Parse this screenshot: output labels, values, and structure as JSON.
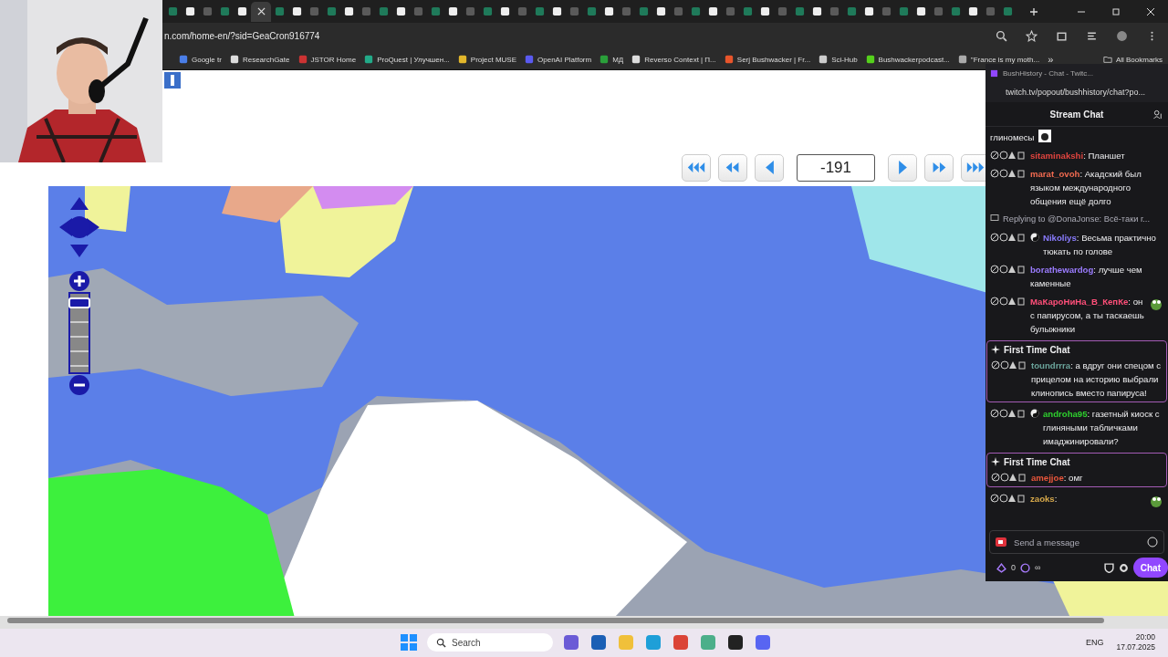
{
  "browser": {
    "tabs": [
      {
        "selected": false
      },
      {
        "selected": false
      },
      {
        "selected": false
      },
      {
        "selected": false
      },
      {
        "selected": false
      },
      {
        "selected": true
      },
      {
        "selected": false
      },
      {
        "selected": false
      },
      {
        "selected": false
      },
      {
        "selected": false
      },
      {
        "selected": false
      },
      {
        "selected": false
      },
      {
        "selected": false
      },
      {
        "selected": false
      },
      {
        "selected": false
      },
      {
        "selected": false
      },
      {
        "selected": false
      },
      {
        "selected": false
      },
      {
        "selected": false
      },
      {
        "selected": false
      },
      {
        "selected": false
      },
      {
        "selected": false
      },
      {
        "selected": false
      },
      {
        "selected": false
      },
      {
        "selected": false
      },
      {
        "selected": false
      },
      {
        "selected": false
      },
      {
        "selected": false
      },
      {
        "selected": false
      },
      {
        "selected": false
      },
      {
        "selected": false
      },
      {
        "selected": false
      },
      {
        "selected": false
      },
      {
        "selected": false
      },
      {
        "selected": false
      },
      {
        "selected": false
      },
      {
        "selected": false
      },
      {
        "selected": false
      },
      {
        "selected": false
      },
      {
        "selected": false
      },
      {
        "selected": false
      },
      {
        "selected": false
      },
      {
        "selected": false
      },
      {
        "selected": false
      },
      {
        "selected": false
      },
      {
        "selected": false
      },
      {
        "selected": false
      },
      {
        "selected": false
      },
      {
        "selected": false
      }
    ],
    "address": "n.com/home-en/?sid=GeaCron916774",
    "bookmarks": [
      "Google tr",
      "ResearchGate",
      "JSTOR Home",
      "ProQuest | Улучшен...",
      "Project MUSE",
      "OpenAI Platform",
      "МД",
      "Reverso Context | П...",
      "Serj Bushwacker | Fr...",
      "Sci-Hub",
      "Bushwackerpodcast...",
      "\"France is my moth..."
    ],
    "more": "»",
    "all_bookmarks": "All Bookmarks"
  },
  "page": {
    "year": "-191",
    "zoom": {
      "level": 0.95
    }
  },
  "chat": {
    "title": "BushHistory - Chat - Twitc...",
    "url": "twitch.tv/popout/bushhistory/chat?po...",
    "header": "Stream Chat",
    "messages": [
      {
        "kind": "continuation",
        "text": "глиномесы",
        "emote": true
      },
      {
        "kind": "message",
        "user": "sitaminakshi",
        "color": "#e0443e",
        "text": ": Планшет",
        "emote": false,
        "badge": false
      },
      {
        "kind": "message",
        "user": "marat_ovoh",
        "color": "#f06a50",
        "text": ": Акадский был языком международного общения ещё долго",
        "emote": false,
        "badge": false
      },
      {
        "kind": "reply",
        "text": "Replying to @DonaJonse: Всё-таки г..."
      },
      {
        "kind": "message",
        "user": "Nikoliys",
        "color": "#8a7cff",
        "text": ": Весьма практично тюкать по голове",
        "emote": false,
        "badge": true
      },
      {
        "kind": "message",
        "user": "borathewardog",
        "color": "#9b7cff",
        "text": ": лучше чем каменные",
        "emote": false,
        "badge": false
      },
      {
        "kind": "message",
        "user": "МаКароНиНа_В_КепКе",
        "color": "#ff4f79",
        "text": ": он с папирусом, а ты таскаешь булыжники",
        "emote": true,
        "badge": false
      },
      {
        "kind": "first_time",
        "label": "First Time Chat",
        "user": "toundrrra",
        "color": "#6aa39a",
        "text": ": а вдруг они спецом с прицелом на историю выбрали клинопись вместо папируса!",
        "emote": false,
        "badge": false
      },
      {
        "kind": "message",
        "user": "androha95",
        "color": "#2ed12e",
        "text": ": газетный киоск с глиняными табличками имаджинировали?",
        "emote": false,
        "badge": true
      },
      {
        "kind": "first_time",
        "label": "First Time Chat",
        "user": "amejjoe",
        "color": "#e8553b",
        "text": ": омг",
        "emote": false,
        "badge": false
      },
      {
        "kind": "message",
        "user": "zaoks",
        "color": "#d6a84a",
        "text": ":",
        "emote": true,
        "badge": false
      }
    ],
    "placeholder": "Send a message",
    "points": "0",
    "infinity": "∞",
    "send": "Chat"
  },
  "taskbar": {
    "search": "Search",
    "lang": "ENG",
    "time": "20:00",
    "date": "17.07.2025"
  }
}
